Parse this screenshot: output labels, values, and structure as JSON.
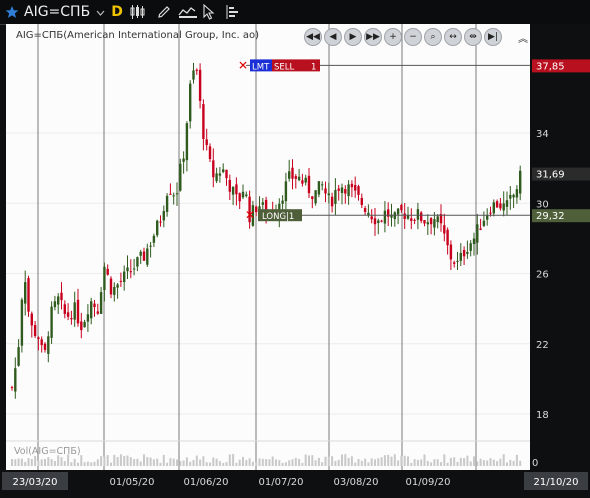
{
  "toolbar": {
    "ticker": "AIG=СПБ",
    "timeframe": "D"
  },
  "chart": {
    "legend": "AIG=СПБ(American International Group, Inc. ao)",
    "volume_legend": "Vol(AIG=СПБ)",
    "volume_zero": "0",
    "price_ticks": [
      "34",
      "30",
      "26",
      "22",
      "18"
    ],
    "date_ticks": [
      "01/05/20",
      "01/06/20",
      "01/07/20",
      "03/08/20",
      "01/09/20"
    ],
    "date_start": "23/03/20",
    "date_end": "21/10/20",
    "orders": {
      "limit": {
        "type": "LMT",
        "side": "SELL",
        "qty": "1",
        "price": "37,85"
      },
      "position": {
        "label": "LONG|1",
        "price": "29,32"
      }
    },
    "last_price": "31,69",
    "colors": {
      "up": "#2f5b1e",
      "down": "#c8001e",
      "sell_line": "#b9101f",
      "long_line": "#4f5f3a"
    }
  }
}
